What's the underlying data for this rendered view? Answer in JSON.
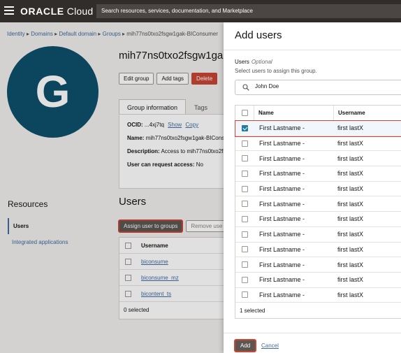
{
  "topbar": {
    "logo_bold": "ORACLE",
    "logo_rest": " Cloud",
    "search_placeholder": "Search resources, services, documentation, and Marketplace"
  },
  "breadcrumb": [
    "Identity",
    "Domains",
    "Default domain",
    "Groups"
  ],
  "breadcrumb_current": "mih77ns0txo2fsgw1gak-BIConsumer",
  "avatar_letter": "G",
  "group_title": "mih77ns0txo2fsgw1ga",
  "buttons": {
    "edit": "Edit group",
    "tags": "Add tags",
    "delete": "Delete"
  },
  "tabs": {
    "info": "Group information",
    "tags": "Tags"
  },
  "info": {
    "ocid_label": "OCID:",
    "ocid_value": "...4xj7tq",
    "show": "Show",
    "copy": "Copy",
    "name_label": "Name:",
    "name_value": "mih77ns0txo2fsgw1gak-BICons",
    "desc_label": "Description:",
    "desc_value": "Access to mih77ns0txo2fs",
    "access_label": "User can request access:",
    "access_value": "No"
  },
  "resources": {
    "title": "Resources",
    "items": [
      "Users",
      "Integrated applications"
    ]
  },
  "users_section": {
    "title": "Users",
    "assign_btn": "Assign user to groups",
    "remove_btn": "Remove use",
    "col_username": "Username",
    "rows": [
      "biconsume",
      "biconsume_mz",
      "bicontent_ts"
    ],
    "footer": "0 selected"
  },
  "drawer": {
    "title": "Add users",
    "field_label": "Users",
    "field_optional": "Optional",
    "field_help": "Select users to assign this group.",
    "search_value": "John Doe",
    "col_name": "Name",
    "col_username": "Username",
    "rows": [
      {
        "name": "First Lastname -",
        "username": "first lastX",
        "checked": true
      },
      {
        "name": "First Lastname -",
        "username": "first lastX",
        "checked": false
      },
      {
        "name": "First Lastname -",
        "username": "first lastX",
        "checked": false
      },
      {
        "name": "First Lastname -",
        "username": "first lastX",
        "checked": false
      },
      {
        "name": "First Lastname -",
        "username": "first lastX",
        "checked": false
      },
      {
        "name": "First Lastname -",
        "username": "first lastX",
        "checked": false
      },
      {
        "name": "First Lastname -",
        "username": "first lastX",
        "checked": false
      },
      {
        "name": "First Lastname -",
        "username": "first lastX",
        "checked": false
      },
      {
        "name": "First Lastname -",
        "username": "first lastX",
        "checked": false
      },
      {
        "name": "First Lastname -",
        "username": "first lastX",
        "checked": false
      },
      {
        "name": "First Lastname -",
        "username": "first lastX",
        "checked": false
      },
      {
        "name": "First Lastname -",
        "username": "first lastX",
        "checked": false
      }
    ],
    "footer": "1 selected",
    "add_btn": "Add",
    "cancel": "Cancel"
  },
  "colors": {
    "brand_red": "#c74634",
    "topbar": "#312d2a",
    "avatar": "#0e4f6b",
    "check": "#227e9e",
    "link": "#3f6ca0"
  }
}
